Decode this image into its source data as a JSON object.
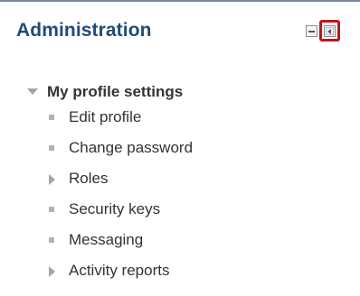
{
  "block": {
    "title": "Administration",
    "controls": {
      "hide_icon": "minus-box-icon",
      "dock_icon": "dock-left-icon",
      "highlight_color": "#c0141b"
    }
  },
  "tree": {
    "section": {
      "label": "My profile settings",
      "expanded": true,
      "icon": "triangle-down-icon"
    },
    "items": [
      {
        "label": "Edit profile",
        "icon": "square-bullet-icon"
      },
      {
        "label": "Change password",
        "icon": "square-bullet-icon"
      },
      {
        "label": "Roles",
        "icon": "triangle-right-icon"
      },
      {
        "label": "Security keys",
        "icon": "square-bullet-icon"
      },
      {
        "label": "Messaging",
        "icon": "square-bullet-icon"
      },
      {
        "label": "Activity reports",
        "icon": "triangle-right-icon"
      }
    ]
  },
  "colors": {
    "title": "#1f4b78",
    "text": "#333333",
    "bullet": "#b3b3b3",
    "top_border": "#7a86a6"
  }
}
